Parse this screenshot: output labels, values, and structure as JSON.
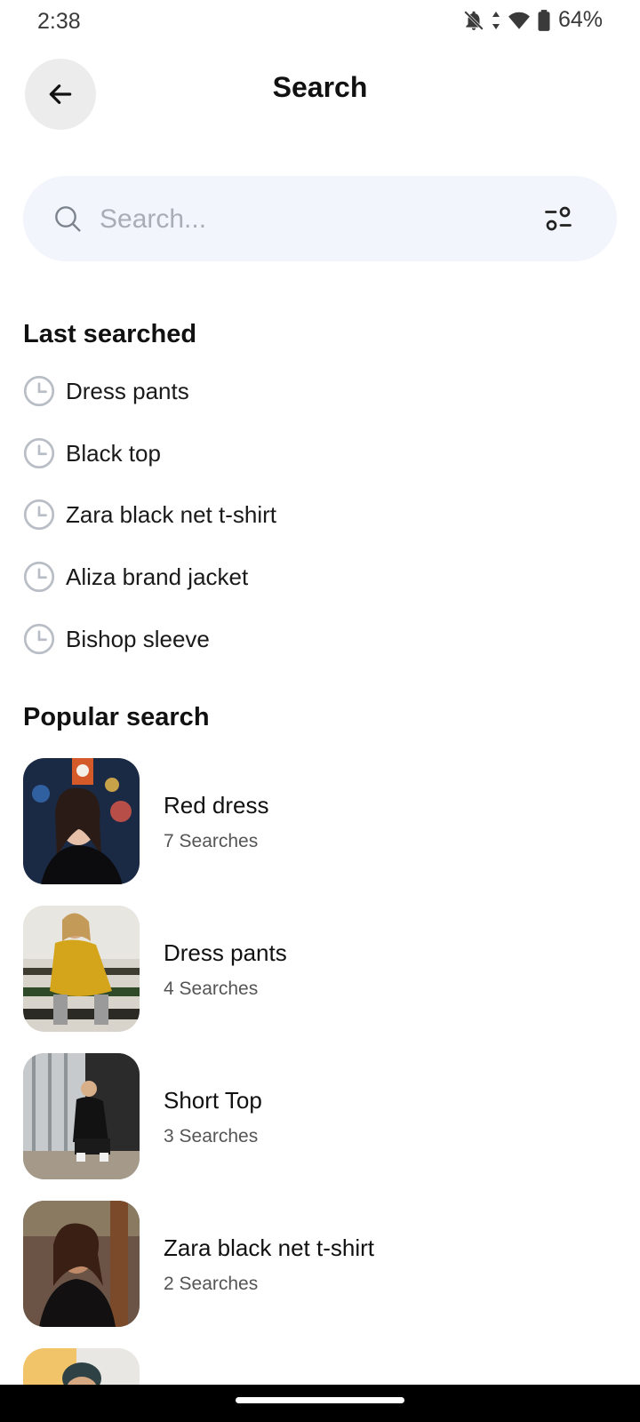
{
  "status": {
    "time": "2:38",
    "battery": "64%",
    "icons": [
      "bell-off-icon",
      "data-arrows-icon",
      "wifi-icon",
      "battery-icon"
    ]
  },
  "header": {
    "back_icon": "arrow-left-icon",
    "title": "Search"
  },
  "search": {
    "placeholder": "Search...",
    "value": "",
    "search_icon": "search-icon",
    "filter_icon": "filter-sliders-icon"
  },
  "recent": {
    "title": "Last searched",
    "icon": "clock-icon",
    "items": [
      {
        "label": "Dress pants"
      },
      {
        "label": "Black top"
      },
      {
        "label": "Zara black net t-shirt"
      },
      {
        "label": "Aliza brand jacket"
      },
      {
        "label": "Bishop sleeve"
      }
    ]
  },
  "popular": {
    "title": "Popular search",
    "items": [
      {
        "title": "Red dress",
        "count": "7 Searches"
      },
      {
        "title": "Dress pants",
        "count": "4 Searches"
      },
      {
        "title": "Short Top",
        "count": "3 Searches"
      },
      {
        "title": "Zara black net t-shirt",
        "count": "2 Searches"
      }
    ]
  },
  "colors": {
    "search_bg": "#f2f5fb",
    "back_button_bg": "#ececec",
    "placeholder": "#a8adb6",
    "clock_stroke": "#b9bec6"
  }
}
